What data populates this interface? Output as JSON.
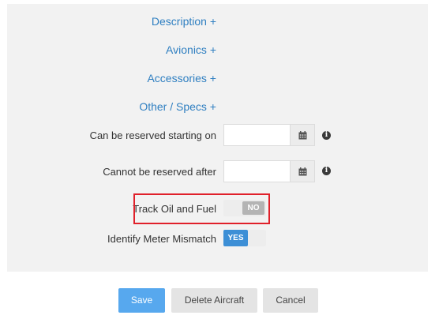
{
  "sections": {
    "description": "Description +",
    "avionics": "Avionics +",
    "accessories": "Accessories +",
    "other_specs": "Other / Specs +"
  },
  "fields": {
    "reserve_start": {
      "label": "Can be reserved starting on",
      "value": "",
      "icon": "calendar-icon",
      "info_icon": "info-icon"
    },
    "reserve_end": {
      "label": "Cannot be reserved after",
      "value": "",
      "icon": "calendar-icon",
      "info_icon": "info-icon"
    },
    "track_oil_fuel": {
      "label": "Track Oil and Fuel",
      "state": "NO"
    },
    "identify_meter_mismatch": {
      "label": "Identify Meter Mismatch",
      "state": "YES"
    }
  },
  "buttons": {
    "save": "Save",
    "delete": "Delete Aircraft",
    "cancel": "Cancel"
  },
  "colors": {
    "link": "#2f7fc1",
    "highlight": "#e0202a",
    "toggle_on": "#3d8fd6",
    "save_button": "#57a8ee"
  }
}
